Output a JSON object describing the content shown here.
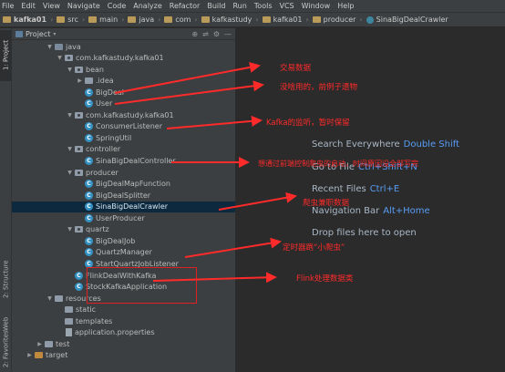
{
  "menu": [
    "File",
    "Edit",
    "View",
    "Navigate",
    "Code",
    "Analyze",
    "Refactor",
    "Build",
    "Run",
    "Tools",
    "VCS",
    "Window",
    "Help"
  ],
  "breadcrumb": [
    "kafka01",
    "src",
    "main",
    "java",
    "com",
    "kafkastudy",
    "kafka01",
    "producer",
    "SinaBigDealCrawler"
  ],
  "left_strip": {
    "project": "1: Project",
    "structure": "2: Structure",
    "web": "Web",
    "favorites": "2: Favorites"
  },
  "panel": {
    "title": "Project",
    "tools": [
      "⊕",
      "⇌",
      "⚙",
      "—"
    ]
  },
  "tree": [
    {
      "label": "java",
      "depth": 4,
      "icon": "folder-src",
      "arrow": "down"
    },
    {
      "label": "com.kafkastudy.kafka01",
      "depth": 5,
      "icon": "package",
      "arrow": "down"
    },
    {
      "label": "bean",
      "depth": 6,
      "icon": "package",
      "arrow": "down"
    },
    {
      "label": ".idea",
      "depth": 7,
      "icon": "folder",
      "arrow": "right"
    },
    {
      "label": "BigDeal",
      "depth": 7,
      "icon": "class",
      "arrow": ""
    },
    {
      "label": "User",
      "depth": 7,
      "icon": "class",
      "arrow": ""
    },
    {
      "label": "com.kafkastudy.kafka01",
      "depth": 6,
      "icon": "package",
      "arrow": "down"
    },
    {
      "label": "ConsumerListener",
      "depth": 7,
      "icon": "class",
      "arrow": ""
    },
    {
      "label": "SpringUtil",
      "depth": 7,
      "icon": "class",
      "arrow": ""
    },
    {
      "label": "controller",
      "depth": 6,
      "icon": "package",
      "arrow": "down"
    },
    {
      "label": "SinaBigDealController",
      "depth": 7,
      "icon": "class",
      "arrow": ""
    },
    {
      "label": "producer",
      "depth": 6,
      "icon": "package",
      "arrow": "down"
    },
    {
      "label": "BigDealMapFunction",
      "depth": 7,
      "icon": "class",
      "arrow": ""
    },
    {
      "label": "BigDealSplitter",
      "depth": 7,
      "icon": "class",
      "arrow": ""
    },
    {
      "label": "SinaBigDealCrawler",
      "depth": 7,
      "icon": "class",
      "arrow": "",
      "selected": true
    },
    {
      "label": "UserProducer",
      "depth": 7,
      "icon": "class",
      "arrow": ""
    },
    {
      "label": "quartz",
      "depth": 6,
      "icon": "package",
      "arrow": "down"
    },
    {
      "label": "BigDealJob",
      "depth": 7,
      "icon": "class",
      "arrow": ""
    },
    {
      "label": "QuartzManager",
      "depth": 7,
      "icon": "class",
      "arrow": ""
    },
    {
      "label": "StartQuartzJobListener",
      "depth": 7,
      "icon": "class",
      "arrow": ""
    },
    {
      "label": "FlinkDealWithKafka",
      "depth": 6,
      "icon": "class",
      "arrow": ""
    },
    {
      "label": "StockKafkaApplication",
      "depth": 6,
      "icon": "class",
      "arrow": ""
    },
    {
      "label": "resources",
      "depth": 4,
      "icon": "folder",
      "arrow": "down"
    },
    {
      "label": "static",
      "depth": 5,
      "icon": "folder",
      "arrow": ""
    },
    {
      "label": "templates",
      "depth": 5,
      "icon": "folder",
      "arrow": ""
    },
    {
      "label": "application.properties",
      "depth": 5,
      "icon": "file",
      "arrow": ""
    },
    {
      "label": "test",
      "depth": 3,
      "icon": "folder",
      "arrow": "right"
    },
    {
      "label": "target",
      "depth": 2,
      "icon": "folder-orange",
      "arrow": "right"
    }
  ],
  "editor_hints": [
    {
      "label": "Search Everywhere",
      "key": "Double Shift"
    },
    {
      "label": "Go to File",
      "key": "Ctrl+Shift+N"
    },
    {
      "label": "Recent Files",
      "key": "Ctrl+E"
    },
    {
      "label": "Navigation Bar",
      "key": "Alt+Home"
    },
    {
      "label": "Drop files here to open",
      "key": ""
    }
  ],
  "annotations": [
    "交易数据",
    "没啥用的，前例子遗物",
    "Kafka的监听，暂时保留",
    "想通过前端控制爬虫的启动，时间原因没全部写完",
    "爬虫兼职数据",
    "定时器跑“小爬虫”",
    "Flink处理数据类"
  ],
  "colors": {
    "annotation": "#ff2a2a",
    "selection": "#0d293e",
    "key": "#589df6"
  }
}
